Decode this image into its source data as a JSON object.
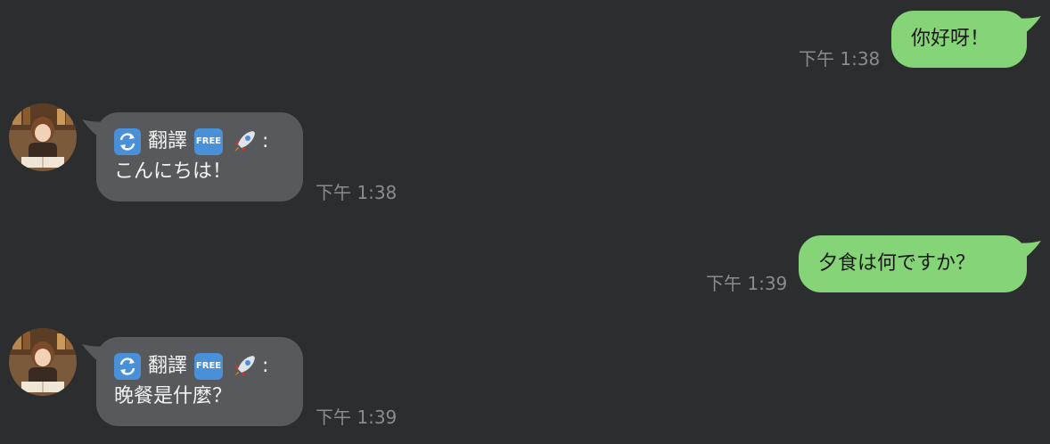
{
  "messages": [
    {
      "id": "m1",
      "direction": "outgoing",
      "text": "你好呀！",
      "time": "下午 1:38"
    },
    {
      "id": "m2",
      "direction": "incoming",
      "prefix_label": "翻譯",
      "free_label": "FREE",
      "colon": ":",
      "text": "こんにちは！",
      "time": "下午 1:38"
    },
    {
      "id": "m3",
      "direction": "outgoing",
      "text": "夕食は何ですか？",
      "time": "下午 1:39"
    },
    {
      "id": "m4",
      "direction": "incoming",
      "prefix_label": "翻譯",
      "free_label": "FREE",
      "colon": ":",
      "text": "晚餐是什麼？",
      "time": "下午 1:39"
    }
  ],
  "colors": {
    "background": "#2c2d2f",
    "outgoing_bubble": "#85d477",
    "incoming_bubble": "#58595c",
    "timestamp": "#8a8b8d"
  },
  "icons": [
    "translate-refresh-icon",
    "free-badge-icon",
    "rocket-icon",
    "bot-avatar"
  ]
}
